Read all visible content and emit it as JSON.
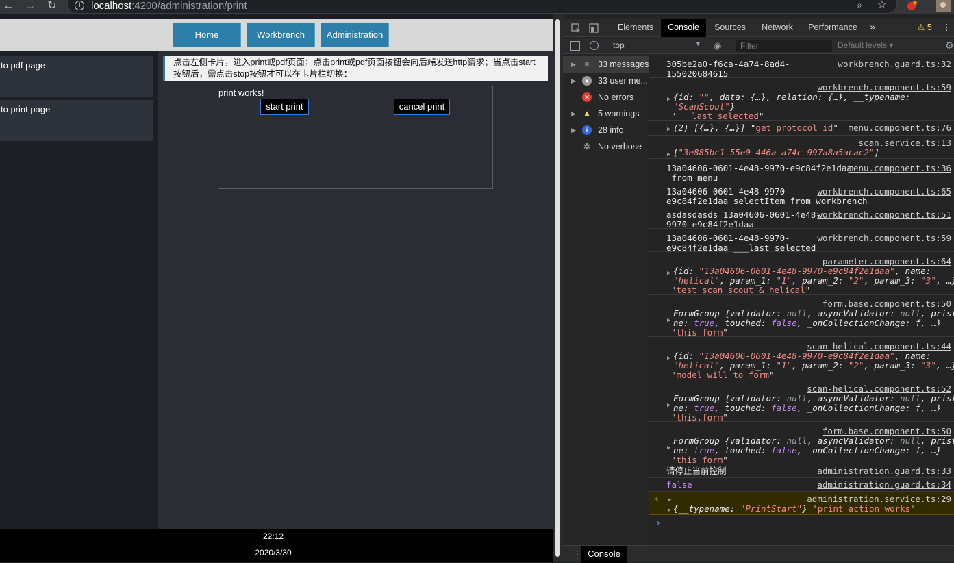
{
  "browser": {
    "url_host": "localhost",
    "url_path": ":4200/administration/print"
  },
  "app": {
    "nav": [
      "Home",
      "Workbrench",
      "Administration"
    ],
    "sidebar_cards": [
      "to pdf page",
      "to print page"
    ],
    "notice": "点击左侧卡片，进入print或pdf页面；点击print或pdf页面按钮会向后端发送http请求；当点击start按钮后，需点击stop按钮才可以在卡片栏切换：",
    "print_title": "print works!",
    "start_label": "start print",
    "cancel_label": "cancel print",
    "footer_time": "22:12",
    "footer_date": "2020/3/30"
  },
  "devtools": {
    "tabs": [
      "Elements",
      "Console",
      "Sources",
      "Network",
      "Performance"
    ],
    "more_tabs": "»",
    "warnings_badge": "5",
    "context": "top",
    "filter_placeholder": "Filter",
    "levels": "Default levels",
    "sidebar": [
      "33 messages",
      "33 user me...",
      "No errors",
      "5 warnings",
      "28 info",
      "No verbose"
    ],
    "drawer_tab": "Console",
    "prompt": "›"
  }
}
